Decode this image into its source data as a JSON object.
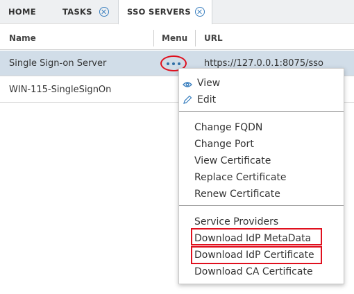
{
  "tabs": {
    "home": "HOME",
    "tasks": "TASKS",
    "sso_servers": "SSO SERVERS"
  },
  "grid": {
    "columns": [
      "Name",
      "Menu",
      "URL"
    ],
    "rows": [
      {
        "name": "Single Sign-on Server",
        "url": "https://127.0.0.1:8075/sso"
      },
      {
        "name": "WIN-115-SingleSignOn",
        "url": ""
      }
    ]
  },
  "menu": {
    "view": "View",
    "edit": "Edit",
    "change_fqdn": "Change FQDN",
    "change_port": "Change Port",
    "view_certificate": "View Certificate",
    "replace_certificate": "Replace Certificate",
    "renew_certificate": "Renew Certificate",
    "service_providers": "Service Providers",
    "download_idp_metadata": "Download IdP MetaData",
    "download_idp_certificate": "Download IdP Certificate",
    "download_ca_certificate": "Download CA Certificate"
  },
  "colors": {
    "accent": "#3a7fbf",
    "selected_row": "#d1dde8",
    "annotation_red": "#e0101e"
  }
}
